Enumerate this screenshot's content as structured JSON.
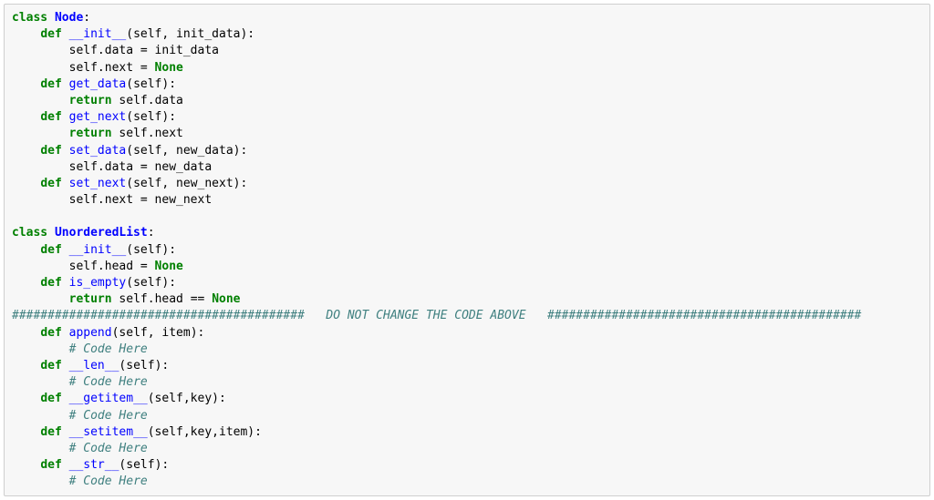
{
  "code": {
    "lines": [
      [
        [
          "k",
          "class "
        ],
        [
          "nc",
          "Node"
        ],
        [
          "p",
          ":"
        ]
      ],
      [
        [
          "n",
          "    "
        ],
        [
          "k",
          "def "
        ],
        [
          "fn",
          "__init__"
        ],
        [
          "p",
          "("
        ],
        [
          "n",
          "self, init_data"
        ],
        [
          "p",
          "):"
        ]
      ],
      [
        [
          "n",
          "        self"
        ],
        [
          "p",
          "."
        ],
        [
          "n",
          "data "
        ],
        [
          "p",
          "= "
        ],
        [
          "n",
          "init_data"
        ]
      ],
      [
        [
          "n",
          "        self"
        ],
        [
          "p",
          "."
        ],
        [
          "n",
          "next "
        ],
        [
          "p",
          "= "
        ],
        [
          "bn",
          "None"
        ]
      ],
      [
        [
          "n",
          "    "
        ],
        [
          "k",
          "def "
        ],
        [
          "fn",
          "get_data"
        ],
        [
          "p",
          "("
        ],
        [
          "n",
          "self"
        ],
        [
          "p",
          "):"
        ]
      ],
      [
        [
          "n",
          "        "
        ],
        [
          "k",
          "return "
        ],
        [
          "n",
          "self"
        ],
        [
          "p",
          "."
        ],
        [
          "n",
          "data"
        ]
      ],
      [
        [
          "n",
          "    "
        ],
        [
          "k",
          "def "
        ],
        [
          "fn",
          "get_next"
        ],
        [
          "p",
          "("
        ],
        [
          "n",
          "self"
        ],
        [
          "p",
          "):"
        ]
      ],
      [
        [
          "n",
          "        "
        ],
        [
          "k",
          "return "
        ],
        [
          "n",
          "self"
        ],
        [
          "p",
          "."
        ],
        [
          "n",
          "next"
        ]
      ],
      [
        [
          "n",
          "    "
        ],
        [
          "k",
          "def "
        ],
        [
          "fn",
          "set_data"
        ],
        [
          "p",
          "("
        ],
        [
          "n",
          "self, new_data"
        ],
        [
          "p",
          "):"
        ]
      ],
      [
        [
          "n",
          "        self"
        ],
        [
          "p",
          "."
        ],
        [
          "n",
          "data "
        ],
        [
          "p",
          "= "
        ],
        [
          "n",
          "new_data"
        ]
      ],
      [
        [
          "n",
          "    "
        ],
        [
          "k",
          "def "
        ],
        [
          "fn",
          "set_next"
        ],
        [
          "p",
          "("
        ],
        [
          "n",
          "self, new_next"
        ],
        [
          "p",
          "):"
        ]
      ],
      [
        [
          "n",
          "        self"
        ],
        [
          "p",
          "."
        ],
        [
          "n",
          "next "
        ],
        [
          "p",
          "= "
        ],
        [
          "n",
          "new_next"
        ]
      ],
      [
        [
          "n",
          ""
        ]
      ],
      [
        [
          "k",
          "class "
        ],
        [
          "nc",
          "UnorderedList"
        ],
        [
          "p",
          ":"
        ]
      ],
      [
        [
          "n",
          "    "
        ],
        [
          "k",
          "def "
        ],
        [
          "fn",
          "__init__"
        ],
        [
          "p",
          "("
        ],
        [
          "n",
          "self"
        ],
        [
          "p",
          "):"
        ]
      ],
      [
        [
          "n",
          "        self"
        ],
        [
          "p",
          "."
        ],
        [
          "n",
          "head "
        ],
        [
          "p",
          "= "
        ],
        [
          "bn",
          "None"
        ]
      ],
      [
        [
          "n",
          "    "
        ],
        [
          "k",
          "def "
        ],
        [
          "fn",
          "is_empty"
        ],
        [
          "p",
          "("
        ],
        [
          "n",
          "self"
        ],
        [
          "p",
          "):"
        ]
      ],
      [
        [
          "n",
          "        "
        ],
        [
          "k",
          "return "
        ],
        [
          "n",
          "self"
        ],
        [
          "p",
          "."
        ],
        [
          "n",
          "head "
        ],
        [
          "p",
          "== "
        ],
        [
          "bn",
          "None"
        ]
      ],
      [
        [
          "c",
          "#########################################   DO NOT CHANGE THE CODE ABOVE   ############################################"
        ]
      ],
      [
        [
          "n",
          "    "
        ],
        [
          "k",
          "def "
        ],
        [
          "fn",
          "append"
        ],
        [
          "p",
          "("
        ],
        [
          "n",
          "self, item"
        ],
        [
          "p",
          "):"
        ]
      ],
      [
        [
          "n",
          "        "
        ],
        [
          "c",
          "# Code Here"
        ]
      ],
      [
        [
          "n",
          "    "
        ],
        [
          "k",
          "def "
        ],
        [
          "fn",
          "__len__"
        ],
        [
          "p",
          "("
        ],
        [
          "n",
          "self"
        ],
        [
          "p",
          "):"
        ]
      ],
      [
        [
          "n",
          "        "
        ],
        [
          "c",
          "# Code Here"
        ]
      ],
      [
        [
          "n",
          "    "
        ],
        [
          "k",
          "def "
        ],
        [
          "fn",
          "__getitem__"
        ],
        [
          "p",
          "("
        ],
        [
          "n",
          "self,key"
        ],
        [
          "p",
          "):"
        ]
      ],
      [
        [
          "n",
          "        "
        ],
        [
          "c",
          "# Code Here"
        ]
      ],
      [
        [
          "n",
          "    "
        ],
        [
          "k",
          "def "
        ],
        [
          "fn",
          "__setitem__"
        ],
        [
          "p",
          "("
        ],
        [
          "n",
          "self,key,item"
        ],
        [
          "p",
          "):"
        ]
      ],
      [
        [
          "n",
          "        "
        ],
        [
          "c",
          "# Code Here"
        ]
      ],
      [
        [
          "n",
          "    "
        ],
        [
          "k",
          "def "
        ],
        [
          "fn",
          "__str__"
        ],
        [
          "p",
          "("
        ],
        [
          "n",
          "self"
        ],
        [
          "p",
          "):"
        ]
      ],
      [
        [
          "n",
          "        "
        ],
        [
          "c",
          "# Code Here"
        ]
      ]
    ]
  }
}
